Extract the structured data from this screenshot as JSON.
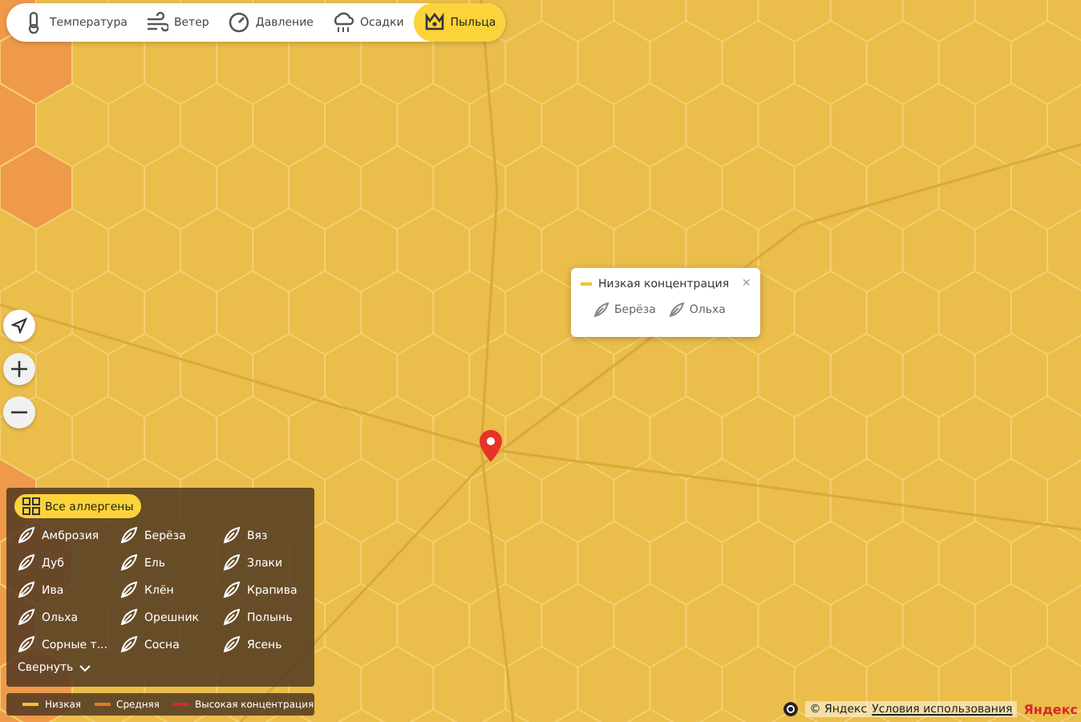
{
  "tabs": [
    {
      "label": "Температура",
      "selected": false
    },
    {
      "label": "Ветер",
      "selected": false
    },
    {
      "label": "Давление",
      "selected": false
    },
    {
      "label": "Осадки",
      "selected": false
    },
    {
      "label": "Пыльца",
      "selected": true
    }
  ],
  "popup": {
    "title": "Низкая концентрация",
    "color": "#f2c230",
    "close": "×",
    "allergens": [
      "Берёза",
      "Ольха"
    ]
  },
  "allergen_panel": {
    "all_button": "Все аллергены",
    "items": [
      "Амброзия",
      "Берёза",
      "Вяз",
      "Дуб",
      "Ель",
      "Злаки",
      "Ива",
      "Клён",
      "Крапива",
      "Ольха",
      "Орешник",
      "Полынь",
      "Сорные т...",
      "Сосна",
      "Ясень"
    ],
    "collapse": "Свернуть"
  },
  "legend": [
    {
      "label": "Низкая",
      "color": "#f2c230"
    },
    {
      "label": "Средняя",
      "color": "#e8772a"
    },
    {
      "label": "Высокая концентрация",
      "color": "#d42a2a"
    }
  ],
  "footer": {
    "copyright": "© Яндекс",
    "terms_link": "Условия использования",
    "logo": "Яндекс"
  }
}
